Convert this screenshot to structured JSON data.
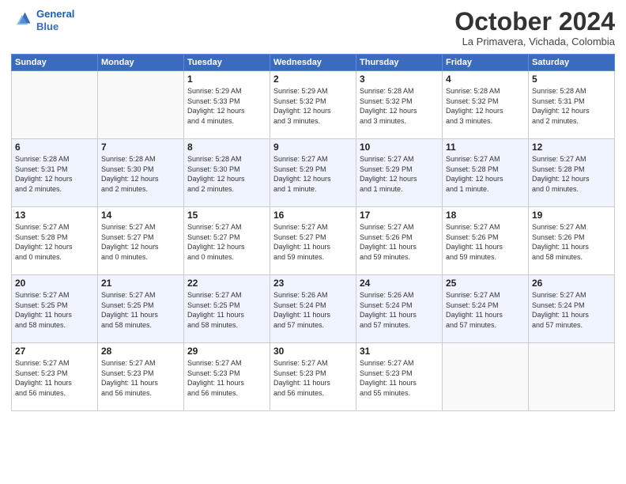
{
  "app": {
    "logo_line1": "General",
    "logo_line2": "Blue"
  },
  "header": {
    "month": "October 2024",
    "location": "La Primavera, Vichada, Colombia"
  },
  "weekdays": [
    "Sunday",
    "Monday",
    "Tuesday",
    "Wednesday",
    "Thursday",
    "Friday",
    "Saturday"
  ],
  "weeks": [
    [
      {
        "day": "",
        "detail": ""
      },
      {
        "day": "",
        "detail": ""
      },
      {
        "day": "1",
        "detail": "Sunrise: 5:29 AM\nSunset: 5:33 PM\nDaylight: 12 hours\nand 4 minutes."
      },
      {
        "day": "2",
        "detail": "Sunrise: 5:29 AM\nSunset: 5:32 PM\nDaylight: 12 hours\nand 3 minutes."
      },
      {
        "day": "3",
        "detail": "Sunrise: 5:28 AM\nSunset: 5:32 PM\nDaylight: 12 hours\nand 3 minutes."
      },
      {
        "day": "4",
        "detail": "Sunrise: 5:28 AM\nSunset: 5:32 PM\nDaylight: 12 hours\nand 3 minutes."
      },
      {
        "day": "5",
        "detail": "Sunrise: 5:28 AM\nSunset: 5:31 PM\nDaylight: 12 hours\nand 2 minutes."
      }
    ],
    [
      {
        "day": "6",
        "detail": "Sunrise: 5:28 AM\nSunset: 5:31 PM\nDaylight: 12 hours\nand 2 minutes."
      },
      {
        "day": "7",
        "detail": "Sunrise: 5:28 AM\nSunset: 5:30 PM\nDaylight: 12 hours\nand 2 minutes."
      },
      {
        "day": "8",
        "detail": "Sunrise: 5:28 AM\nSunset: 5:30 PM\nDaylight: 12 hours\nand 2 minutes."
      },
      {
        "day": "9",
        "detail": "Sunrise: 5:27 AM\nSunset: 5:29 PM\nDaylight: 12 hours\nand 1 minute."
      },
      {
        "day": "10",
        "detail": "Sunrise: 5:27 AM\nSunset: 5:29 PM\nDaylight: 12 hours\nand 1 minute."
      },
      {
        "day": "11",
        "detail": "Sunrise: 5:27 AM\nSunset: 5:28 PM\nDaylight: 12 hours\nand 1 minute."
      },
      {
        "day": "12",
        "detail": "Sunrise: 5:27 AM\nSunset: 5:28 PM\nDaylight: 12 hours\nand 0 minutes."
      }
    ],
    [
      {
        "day": "13",
        "detail": "Sunrise: 5:27 AM\nSunset: 5:28 PM\nDaylight: 12 hours\nand 0 minutes."
      },
      {
        "day": "14",
        "detail": "Sunrise: 5:27 AM\nSunset: 5:27 PM\nDaylight: 12 hours\nand 0 minutes."
      },
      {
        "day": "15",
        "detail": "Sunrise: 5:27 AM\nSunset: 5:27 PM\nDaylight: 12 hours\nand 0 minutes."
      },
      {
        "day": "16",
        "detail": "Sunrise: 5:27 AM\nSunset: 5:27 PM\nDaylight: 11 hours\nand 59 minutes."
      },
      {
        "day": "17",
        "detail": "Sunrise: 5:27 AM\nSunset: 5:26 PM\nDaylight: 11 hours\nand 59 minutes."
      },
      {
        "day": "18",
        "detail": "Sunrise: 5:27 AM\nSunset: 5:26 PM\nDaylight: 11 hours\nand 59 minutes."
      },
      {
        "day": "19",
        "detail": "Sunrise: 5:27 AM\nSunset: 5:26 PM\nDaylight: 11 hours\nand 58 minutes."
      }
    ],
    [
      {
        "day": "20",
        "detail": "Sunrise: 5:27 AM\nSunset: 5:25 PM\nDaylight: 11 hours\nand 58 minutes."
      },
      {
        "day": "21",
        "detail": "Sunrise: 5:27 AM\nSunset: 5:25 PM\nDaylight: 11 hours\nand 58 minutes."
      },
      {
        "day": "22",
        "detail": "Sunrise: 5:27 AM\nSunset: 5:25 PM\nDaylight: 11 hours\nand 58 minutes."
      },
      {
        "day": "23",
        "detail": "Sunrise: 5:26 AM\nSunset: 5:24 PM\nDaylight: 11 hours\nand 57 minutes."
      },
      {
        "day": "24",
        "detail": "Sunrise: 5:26 AM\nSunset: 5:24 PM\nDaylight: 11 hours\nand 57 minutes."
      },
      {
        "day": "25",
        "detail": "Sunrise: 5:27 AM\nSunset: 5:24 PM\nDaylight: 11 hours\nand 57 minutes."
      },
      {
        "day": "26",
        "detail": "Sunrise: 5:27 AM\nSunset: 5:24 PM\nDaylight: 11 hours\nand 57 minutes."
      }
    ],
    [
      {
        "day": "27",
        "detail": "Sunrise: 5:27 AM\nSunset: 5:23 PM\nDaylight: 11 hours\nand 56 minutes."
      },
      {
        "day": "28",
        "detail": "Sunrise: 5:27 AM\nSunset: 5:23 PM\nDaylight: 11 hours\nand 56 minutes."
      },
      {
        "day": "29",
        "detail": "Sunrise: 5:27 AM\nSunset: 5:23 PM\nDaylight: 11 hours\nand 56 minutes."
      },
      {
        "day": "30",
        "detail": "Sunrise: 5:27 AM\nSunset: 5:23 PM\nDaylight: 11 hours\nand 56 minutes."
      },
      {
        "day": "31",
        "detail": "Sunrise: 5:27 AM\nSunset: 5:23 PM\nDaylight: 11 hours\nand 55 minutes."
      },
      {
        "day": "",
        "detail": ""
      },
      {
        "day": "",
        "detail": ""
      }
    ]
  ]
}
